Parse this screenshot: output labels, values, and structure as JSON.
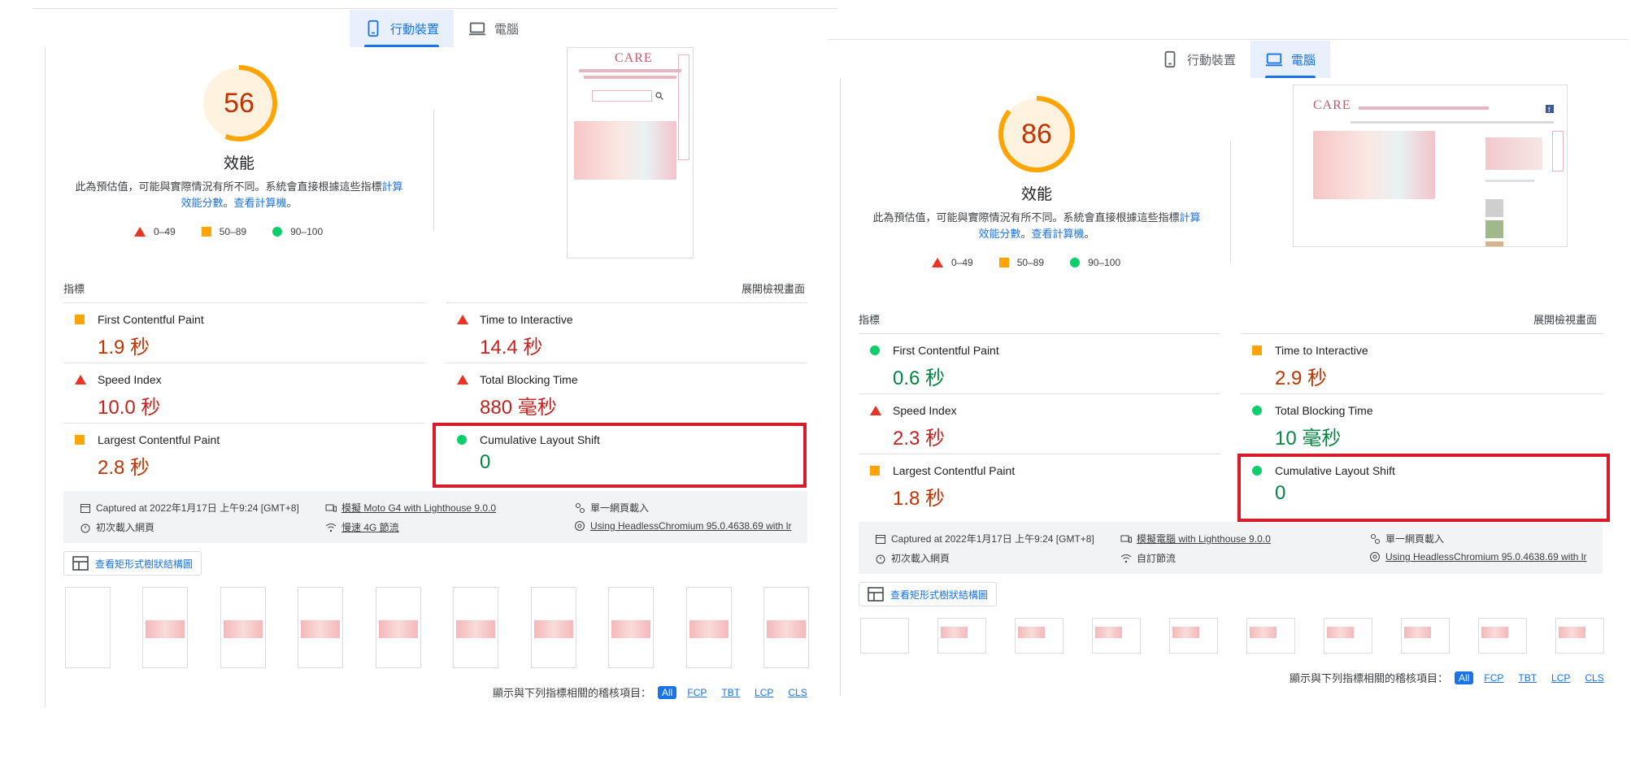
{
  "tabs": {
    "mobile": "行動裝置",
    "desktop": "電腦"
  },
  "left": {
    "score": "56",
    "score_color": "#c33300",
    "category": "效能",
    "desc_part1": "此為預估值，可能與實際情況有所不同。系統會直接根據這些指標",
    "desc_link1": "計算效能分數",
    "desc_sep": "。",
    "desc_link2": "查看計算機",
    "desc_end": "。",
    "legend": {
      "fail": "0–49",
      "average": "50–89",
      "pass": "90–100"
    },
    "metrics_label": "指標",
    "expand_label": "展開檢視畫面",
    "metrics": {
      "fcp": {
        "name": "First Contentful Paint",
        "value": "1.9 秒",
        "status": "average"
      },
      "tti": {
        "name": "Time to Interactive",
        "value": "14.4 秒",
        "status": "fail"
      },
      "si": {
        "name": "Speed Index",
        "value": "10.0 秒",
        "status": "fail"
      },
      "tbt": {
        "name": "Total Blocking Time",
        "value": "880 毫秒",
        "status": "fail"
      },
      "lcp": {
        "name": "Largest Contentful Paint",
        "value": "2.8 秒",
        "status": "average"
      },
      "cls": {
        "name": "Cumulative Layout Shift",
        "value": "0",
        "status": "pass"
      }
    },
    "info": {
      "captured": "Captured at 2022年1月17日 上午9:24 [GMT+8]",
      "device": "模擬 Moto G4 with Lighthouse 9.0.0",
      "session": "單一網頁載入",
      "load": "初次載入網頁",
      "network": "慢速 4G 節流",
      "browser": "Using HeadlessChromium 95.0.4638.69 with lr"
    },
    "tree_button": "查看矩形式樹狀結構圖",
    "filter_label": "顯示與下列指標相關的稽核項目：",
    "filters": [
      "All",
      "FCP",
      "TBT",
      "LCP",
      "CLS"
    ]
  },
  "right": {
    "score": "86",
    "score_color": "#c33300",
    "category": "效能",
    "desc_part1": "此為預估值，可能與實際情況有所不同。系統會直接根據這些指標",
    "desc_link1": "計算效能分數",
    "desc_sep": "。",
    "desc_link2": "查看計算機",
    "desc_end": "。",
    "legend": {
      "fail": "0–49",
      "average": "50–89",
      "pass": "90–100"
    },
    "metrics_label": "指標",
    "expand_label": "展開檢視畫面",
    "metrics": {
      "fcp": {
        "name": "First Contentful Paint",
        "value": "0.6 秒",
        "status": "pass"
      },
      "tti": {
        "name": "Time to Interactive",
        "value": "2.9 秒",
        "status": "average"
      },
      "si": {
        "name": "Speed Index",
        "value": "2.3 秒",
        "status": "fail"
      },
      "tbt": {
        "name": "Total Blocking Time",
        "value": "10 毫秒",
        "status": "pass"
      },
      "lcp": {
        "name": "Largest Contentful Paint",
        "value": "1.8 秒",
        "status": "average"
      },
      "cls": {
        "name": "Cumulative Layout Shift",
        "value": "0",
        "status": "pass"
      }
    },
    "info": {
      "captured": "Captured at 2022年1月17日 上午9:24 [GMT+8]",
      "device": "模擬電腦 with Lighthouse 9.0.0",
      "session": "單一網頁載入",
      "load": "初次載入網頁",
      "network": "自訂節流",
      "browser": "Using HeadlessChromium 95.0.4638.69 with lr"
    },
    "tree_button": "查看矩形式樹狀結構圖",
    "filter_label": "顯示與下列指標相關的稽核項目：",
    "filters": [
      "All",
      "FCP",
      "TBT",
      "LCP",
      "CLS"
    ]
  },
  "colors": {
    "fail": "#eb3223",
    "average": "#ffa400",
    "pass": "#0cce6b",
    "accent": "#1a73e8",
    "highlight": "#d81b2a"
  },
  "logo_text": "CARE"
}
